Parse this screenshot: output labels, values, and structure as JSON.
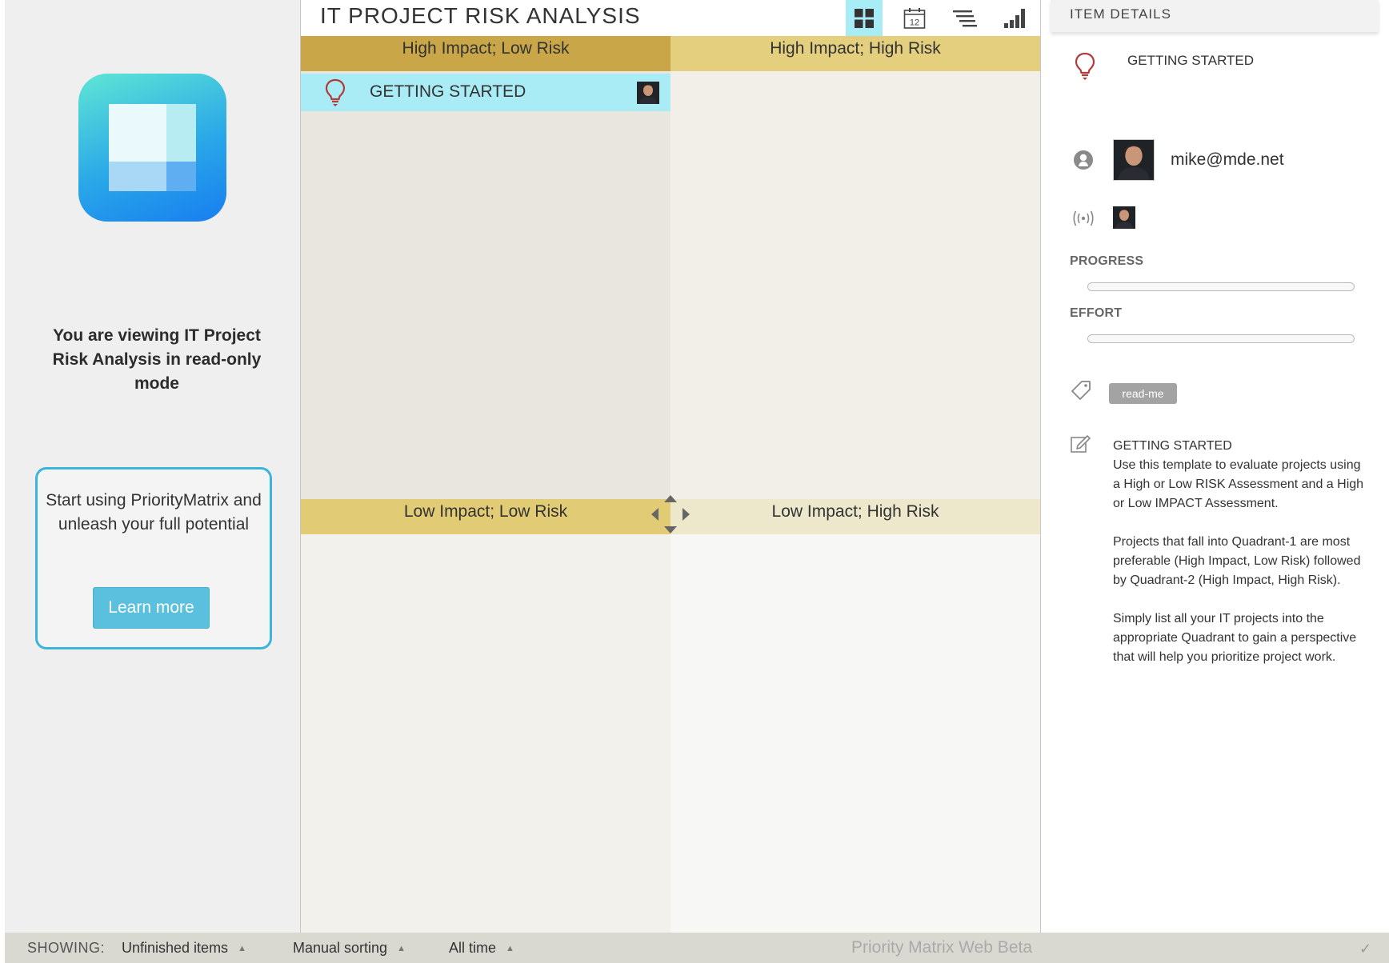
{
  "sidebar": {
    "readonly_message": "You are viewing IT Project Risk Analysis in read-only mode",
    "promo_text": "Start using PriorityMatrix and unleash your full potential",
    "learn_more_label": "Learn more"
  },
  "main": {
    "title": "IT PROJECT RISK ANALYSIS",
    "views": [
      {
        "name": "matrix-view",
        "icon": "grid-icon",
        "active": true
      },
      {
        "name": "calendar-view",
        "icon": "calendar-icon",
        "text": "12"
      },
      {
        "name": "gantt-view",
        "icon": "gantt-icon"
      },
      {
        "name": "report-view",
        "icon": "bar-chart-icon"
      }
    ],
    "quadrants": [
      {
        "label": "High Impact; Low Risk",
        "color": "#c9a647"
      },
      {
        "label": "High Impact; High Risk",
        "color": "#e3cf7d"
      },
      {
        "label": "Low Impact; Low Risk",
        "color": "#e2cb75"
      },
      {
        "label": "Low Impact; High Risk",
        "color": "#ede8cc"
      }
    ],
    "items": [
      {
        "title": "GETTING STARTED",
        "icon": "lightbulb-icon",
        "quadrant": 1
      }
    ]
  },
  "details": {
    "header": "ITEM DETAILS",
    "item_title": "GETTING STARTED",
    "owner_email": "mike@mde.net",
    "progress_label": "PROGRESS",
    "progress_value": 0,
    "effort_label": "EFFORT",
    "effort_value": 0,
    "tag": "read-me",
    "notes": [
      "GETTING STARTED\nUse this template to evaluate projects using a High or Low RISK Assessment and a High or Low IMPACT Assessment.",
      "Projects that fall into Quadrant-1 are most preferable (High Impact, Low Risk) followed by Quadrant-2 (High Impact, High Risk).",
      "Simply list all your IT projects into the appropriate Quadrant to gain a perspective that will help you prioritize project work."
    ]
  },
  "footer": {
    "showing_label": "SHOWING:",
    "filter_items": "Unfinished items",
    "filter_sorting": "Manual sorting",
    "filter_time": "All time",
    "brand": "Priority Matrix Web Beta"
  },
  "colors": {
    "accent": "#5bc0de",
    "active_view": "#a8ecf6",
    "selected_item": "#aaecf6",
    "bulb": "#b23a3a"
  }
}
